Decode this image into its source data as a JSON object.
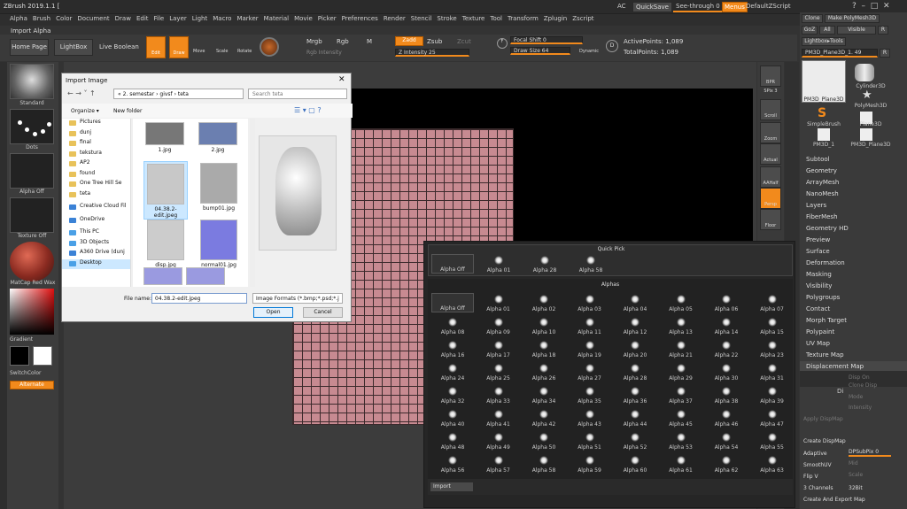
{
  "app": {
    "title": "ZBrush 2019.1.1 [",
    "ac": "AC",
    "quicksave": "QuickSave",
    "seethrough": "See-through   0",
    "menus": "Menus",
    "script": "DefaultZScript"
  },
  "menu": [
    "Alpha",
    "Brush",
    "Color",
    "Document",
    "Draw",
    "Edit",
    "File",
    "Layer",
    "Light",
    "Macro",
    "Marker",
    "Material",
    "Movie",
    "Picker",
    "Preferences",
    "Render",
    "Stencil",
    "Stroke",
    "Texture",
    "Tool",
    "Transform",
    "Zplugin",
    "Zscript"
  ],
  "subtitle": "Import Alpha",
  "toolbar": {
    "home": "Home Page",
    "lightbox": "LightBox",
    "liveboolean": "Live Boolean",
    "edit": "Edit",
    "draw": "Draw",
    "move": "Move",
    "scale": "Scale",
    "rotate": "Rotate",
    "mrgb": "Mrgb",
    "rgb": "Rgb",
    "m": "M",
    "rgb_intensity": "Rgb Intensity",
    "zadd": "Zadd",
    "zsub": "Zsub",
    "zcut": "Zcut",
    "z_intensity": "Z Intensity 25",
    "focal": "Focal Shift 0",
    "drawsize": "Draw Size 64",
    "dynamic": "Dynamic",
    "active": "ActivePoints: 1,089",
    "total": "TotalPoints: 1,089"
  },
  "left": {
    "standard": "Standard",
    "dots": "Dots",
    "alphaoff": "Alpha Off",
    "textureoff": "Texture Off",
    "matcap": "MatCap Red Wax",
    "gradient": "Gradient",
    "switchcolor": "SwitchColor",
    "alternate": "Alternate"
  },
  "righttools": [
    "BPR",
    "SPix 3",
    "Scroll",
    "Zoom",
    "Actual",
    "AAHalf",
    "Persp",
    "Floor"
  ],
  "palette": {
    "top": [
      "Clone",
      "Make PolyMesh3D",
      "GoZ",
      "All",
      "Visible",
      "R",
      "Lightbox▸Tools",
      "PM3D_Plane3D_1. 49",
      "R"
    ],
    "tools": [
      "PM3D_Plane3D",
      "Cylinder3D",
      "PolyMesh3D",
      "SimpleBrush",
      "Plane3D",
      "PM3D_1",
      "PM3D_Plane3D"
    ],
    "items": [
      "Subtool",
      "Geometry",
      "ArrayMesh",
      "NanoMesh",
      "Layers",
      "FiberMesh",
      "Geometry HD",
      "Preview",
      "Surface",
      "Deformation",
      "Masking",
      "Visibility",
      "Polygroups",
      "Contact",
      "Morph Target",
      "Polypaint",
      "UV Map",
      "Texture Map",
      "Displacement Map"
    ],
    "disp": [
      "Disp On",
      "Clone Disp",
      "Mode",
      "Intensity",
      "Di",
      "Apply DispMap",
      "Create DispMap",
      "Adaptive",
      "DPSubPix 0",
      "SmoothUV",
      "Mid",
      "Flip V",
      "Scale",
      "3 Channels",
      "32Bit",
      "Create And Export Map"
    ]
  },
  "dialog": {
    "title": "Import Image",
    "path": "«  2. semestar  ›  givsf  ›  teta",
    "search": "Search teta",
    "organize": "Organize ▾",
    "newfolder": "New folder",
    "tree": [
      "Pictures",
      "dunj",
      "final",
      "tekstura",
      "AP2",
      "found",
      "One Tree Hill Se",
      "teta",
      "Creative Cloud Fil",
      "OneDrive",
      "This PC",
      "3D Objects",
      "A360 Drive (dunj",
      "Desktop"
    ],
    "files": [
      "1.jpg",
      "2.jpg",
      "04.38.2-edit.jpeg",
      "bump01.jpg",
      "disp.jpg",
      "normal01.jpg"
    ],
    "filename_label": "File name:",
    "filename": "04.38.2-edit.jpeg",
    "filter": "Image Formats (*.bmp;*.psd;*.j",
    "open": "Open",
    "cancel": "Cancel"
  },
  "alphas": {
    "quickpick_title": "Quick Pick",
    "quickpick": [
      "Alpha Off",
      "Alpha 01",
      "Alpha 28",
      "Alpha 58"
    ],
    "title": "Alphas",
    "labels": [
      "Alpha Off",
      "Alpha 01",
      "Alpha 02",
      "Alpha 03",
      "Alpha 04",
      "Alpha 05",
      "Alpha 06",
      "Alpha 07",
      "Alpha 08",
      "Alpha 09",
      "Alpha 10",
      "Alpha 11",
      "Alpha 12",
      "Alpha 13",
      "Alpha 14",
      "Alpha 15",
      "Alpha 16",
      "Alpha 17",
      "Alpha 18",
      "Alpha 19",
      "Alpha 20",
      "Alpha 21",
      "Alpha 22",
      "Alpha 23",
      "Alpha 24",
      "Alpha 25",
      "Alpha 26",
      "Alpha 27",
      "Alpha 28",
      "Alpha 29",
      "Alpha 30",
      "Alpha 31",
      "Alpha 32",
      "Alpha 33",
      "Alpha 34",
      "Alpha 35",
      "Alpha 36",
      "Alpha 37",
      "Alpha 38",
      "Alpha 39",
      "Alpha 40",
      "Alpha 41",
      "Alpha 42",
      "Alpha 43",
      "Alpha 44",
      "Alpha 45",
      "Alpha 46",
      "Alpha 47",
      "Alpha 48",
      "Alpha 49",
      "Alpha 50",
      "Alpha 51",
      "Alpha 52",
      "Alpha 53",
      "Alpha 54",
      "Alpha 55",
      "Alpha 56",
      "Alpha 57",
      "Alpha 58",
      "Alpha 59",
      "Alpha 60",
      "Alpha 61",
      "Alpha 62",
      "Alpha 63"
    ],
    "import": "Import"
  }
}
